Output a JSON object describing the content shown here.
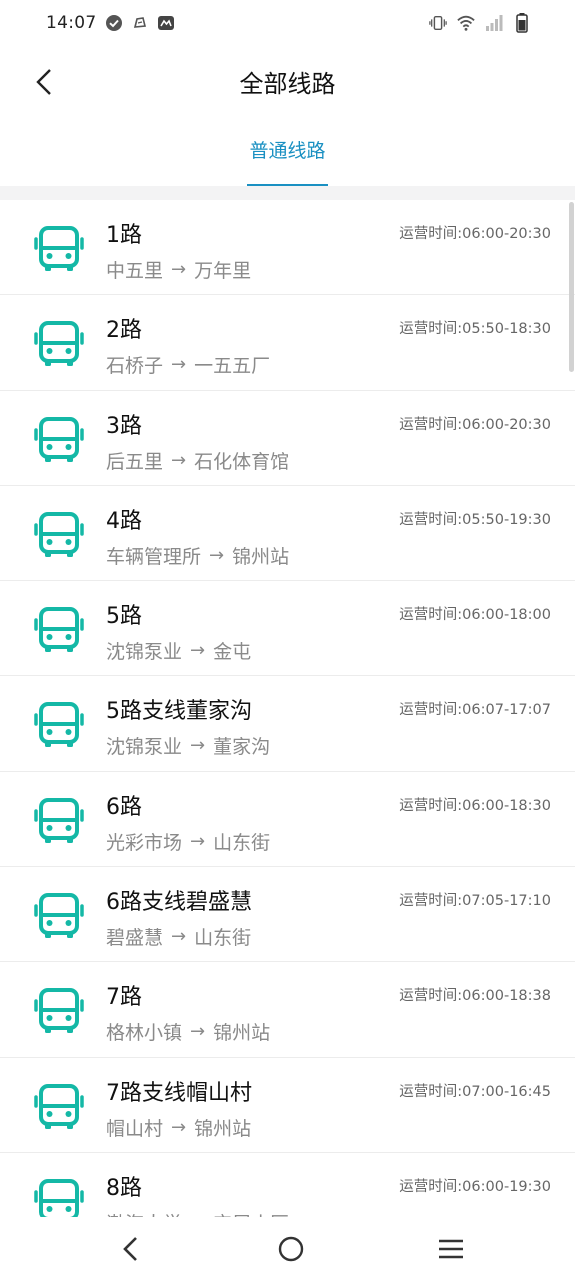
{
  "status_bar": {
    "time": "14:07",
    "icons_left": [
      "check-circle-icon",
      "notification-icon",
      "mail-icon"
    ],
    "icons_right": [
      "vibrate-icon",
      "wifi-icon",
      "signal-icon",
      "battery-icon"
    ]
  },
  "header": {
    "title": "全部线路",
    "back_icon": "chevron-left-icon"
  },
  "tabs": [
    {
      "label": "普通线路",
      "active": true
    }
  ],
  "routes": [
    {
      "name": "1路",
      "from": "中五里",
      "to": "万年里",
      "time": "运营时间:06:00-20:30"
    },
    {
      "name": "2路",
      "from": "石桥子",
      "to": "一五五厂",
      "time": "运营时间:05:50-18:30"
    },
    {
      "name": "3路",
      "from": "后五里",
      "to": "石化体育馆",
      "time": "运营时间:06:00-20:30"
    },
    {
      "name": "4路",
      "from": "车辆管理所",
      "to": "锦州站",
      "time": "运营时间:05:50-19:30"
    },
    {
      "name": "5路",
      "from": "沈锦泵业",
      "to": "金屯",
      "time": "运营时间:06:00-18:00"
    },
    {
      "name": "5路支线董家沟",
      "from": "沈锦泵业",
      "to": "董家沟",
      "time": "运营时间:06:07-17:07"
    },
    {
      "name": "6路",
      "from": "光彩市场",
      "to": "山东街",
      "time": "运营时间:06:00-18:30"
    },
    {
      "name": "6路支线碧盛慧",
      "from": "碧盛慧",
      "to": "山东街",
      "time": "运营时间:07:05-17:10"
    },
    {
      "name": "7路",
      "from": "格林小镇",
      "to": "锦州站",
      "time": "运营时间:06:00-18:38"
    },
    {
      "name": "7路支线帽山村",
      "from": "帽山村",
      "to": "锦州站",
      "time": "运营时间:07:00-16:45"
    },
    {
      "name": "8路",
      "from": "渤海大学",
      "to": "宝居小区",
      "time": "运营时间:06:00-19:30"
    }
  ],
  "route_arrow": "→",
  "colors": {
    "accent": "#1a90c2",
    "bus_icon": "#14b8a6",
    "muted_text": "#8a8a8a"
  },
  "navbar": {
    "icons": [
      "back-triangle-icon",
      "home-circle-icon",
      "menu-icon"
    ]
  }
}
